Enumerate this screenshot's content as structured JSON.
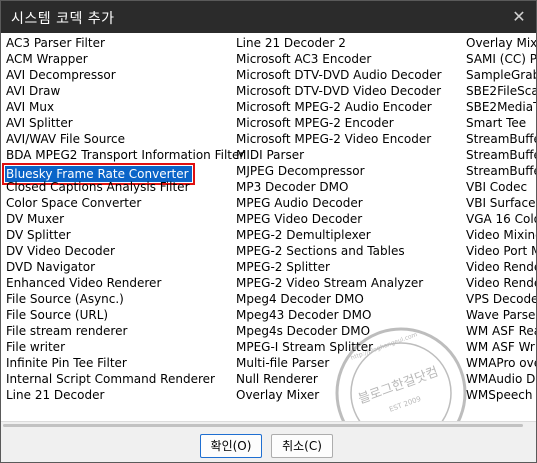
{
  "dialog": {
    "title": "시스템 코덱 추가",
    "close_label": "✕"
  },
  "list": {
    "columns": [
      [
        "AC3 Parser Filter",
        "ACM Wrapper",
        "AVI Decompressor",
        "AVI Draw",
        "AVI Mux",
        "AVI Splitter",
        "AVI/WAV File Source",
        "BDA MPEG2 Transport Information Filter",
        "Bluesky Frame Rate Converter",
        "Closed Captions Analysis Filter",
        "Color Space Converter",
        "DV Muxer",
        "DV Splitter",
        "DV Video Decoder",
        "DVD Navigator",
        "Enhanced Video Renderer",
        "File Source (Async.)",
        "File Source (URL)",
        "File stream renderer",
        "File writer",
        "Infinite Pin Tee Filter",
        "Internal Script Command Renderer",
        "Line 21 Decoder"
      ],
      [
        "Line 21 Decoder 2",
        "Microsoft AC3 Encoder",
        "Microsoft DTV-DVD Audio Decoder",
        "Microsoft DTV-DVD Video Decoder",
        "Microsoft MPEG-2 Audio Encoder",
        "Microsoft MPEG-2 Encoder",
        "Microsoft MPEG-2 Video Encoder",
        "MIDI Parser",
        "MJPEG Decompressor",
        "MP3 Decoder DMO",
        "MPEG Audio Decoder",
        "MPEG Video Decoder",
        "MPEG-2 Demultiplexer",
        "MPEG-2 Sections and Tables",
        "MPEG-2 Splitter",
        "MPEG-2 Video Stream Analyzer",
        "Mpeg4 Decoder DMO",
        "Mpeg43 Decoder DMO",
        "Mpeg4s Decoder DMO",
        "MPEG-I Stream Splitter",
        "Multi-file Parser",
        "Null Renderer",
        "Overlay Mixer"
      ],
      [
        "Overlay Mixe",
        "SAMI (CC) P",
        "SampleGrabb",
        "SBE2FileScar",
        "SBE2MediaTy",
        "Smart Tee",
        "StreamBuffer",
        "StreamBuffer",
        "StreamBuffer",
        "VBI Codec",
        "VBI Surface A",
        "VGA 16 Colo",
        "Video Mixing",
        "Video Port M",
        "Video Render",
        "Video Render",
        "VPS Decoder",
        "Wave Parser",
        "WM ASF Rea",
        "WM ASF Wri",
        "WMAPro ove",
        "WMAudio De",
        "WMSpeech D"
      ]
    ],
    "selected_index": 8
  },
  "buttons": {
    "ok": "확인(O)",
    "cancel": "취소(C)"
  },
  "watermark": {
    "text": "블로그한걸닷컴",
    "url": "http://bloghangeul.com",
    "est": "EST 2009"
  },
  "colors": {
    "selection": "#0a64c8",
    "highlight_box": "#e01010",
    "titlebar": "#2b2b2b"
  }
}
